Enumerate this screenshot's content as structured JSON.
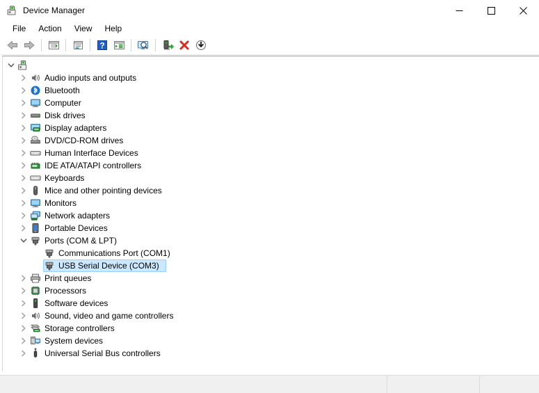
{
  "window": {
    "title": "Device Manager",
    "icon": "device-manager-icon",
    "caption_buttons": [
      {
        "name": "minimize",
        "glyph": "—"
      },
      {
        "name": "maximize",
        "glyph": "□"
      },
      {
        "name": "close",
        "glyph": "✕"
      }
    ]
  },
  "menubar": {
    "items": [
      {
        "label": "File"
      },
      {
        "label": "Action"
      },
      {
        "label": "View"
      },
      {
        "label": "Help"
      }
    ]
  },
  "toolbar": {
    "buttons": [
      {
        "name": "back-button",
        "icon": "back-arrow-icon",
        "tooltip": "Back"
      },
      {
        "name": "forward-button",
        "icon": "forward-arrow-icon",
        "tooltip": "Forward"
      },
      {
        "name": "separator-1",
        "icon": "separator"
      },
      {
        "name": "show-hide-console-tree-button",
        "icon": "console-tree-icon",
        "tooltip": "Show/Hide Console Tree"
      },
      {
        "name": "separator-2",
        "icon": "separator"
      },
      {
        "name": "properties-button",
        "icon": "properties-icon",
        "tooltip": "Properties"
      },
      {
        "name": "separator-3",
        "icon": "separator"
      },
      {
        "name": "help-button",
        "icon": "help-question-icon",
        "tooltip": "Help"
      },
      {
        "name": "view-options-button",
        "icon": "view-list-icon",
        "tooltip": "View"
      },
      {
        "name": "separator-4",
        "icon": "separator"
      },
      {
        "name": "scan-for-hardware-changes-button",
        "icon": "scan-hardware-icon",
        "tooltip": "Scan for hardware changes"
      },
      {
        "name": "separator-5",
        "icon": "separator"
      },
      {
        "name": "enable-device-button",
        "icon": "enable-device-icon",
        "tooltip": "Enable device"
      },
      {
        "name": "uninstall-device-button",
        "icon": "uninstall-red-x-icon",
        "tooltip": "Uninstall device"
      },
      {
        "name": "update-driver-button",
        "icon": "update-driver-download-icon",
        "tooltip": "Update driver"
      }
    ]
  },
  "tree": {
    "nodes": [
      {
        "label": "",
        "icon": "computer-root-icon",
        "level": 0,
        "state": "expanded",
        "selected": false
      },
      {
        "label": "Audio inputs and outputs",
        "icon": "speaker-icon",
        "level": 1,
        "state": "collapsed",
        "selected": false
      },
      {
        "label": "Bluetooth",
        "icon": "bluetooth-icon",
        "level": 1,
        "state": "collapsed",
        "selected": false
      },
      {
        "label": "Computer",
        "icon": "monitor-icon",
        "level": 1,
        "state": "collapsed",
        "selected": false
      },
      {
        "label": "Disk drives",
        "icon": "disk-drive-icon",
        "level": 1,
        "state": "collapsed",
        "selected": false
      },
      {
        "label": "Display adapters",
        "icon": "display-adapter-icon",
        "level": 1,
        "state": "collapsed",
        "selected": false
      },
      {
        "label": "DVD/CD-ROM drives",
        "icon": "optical-drive-icon",
        "level": 1,
        "state": "collapsed",
        "selected": false
      },
      {
        "label": "Human Interface Devices",
        "icon": "hid-icon",
        "level": 1,
        "state": "collapsed",
        "selected": false
      },
      {
        "label": "IDE ATA/ATAPI controllers",
        "icon": "ide-controller-icon",
        "level": 1,
        "state": "collapsed",
        "selected": false
      },
      {
        "label": "Keyboards",
        "icon": "keyboard-icon",
        "level": 1,
        "state": "collapsed",
        "selected": false
      },
      {
        "label": "Mice and other pointing devices",
        "icon": "mouse-icon",
        "level": 1,
        "state": "collapsed",
        "selected": false
      },
      {
        "label": "Monitors",
        "icon": "monitor-icon",
        "level": 1,
        "state": "collapsed",
        "selected": false
      },
      {
        "label": "Network adapters",
        "icon": "network-adapter-icon",
        "level": 1,
        "state": "collapsed",
        "selected": false
      },
      {
        "label": "Portable Devices",
        "icon": "portable-device-icon",
        "level": 1,
        "state": "collapsed",
        "selected": false
      },
      {
        "label": "Ports (COM & LPT)",
        "icon": "port-icon",
        "level": 1,
        "state": "expanded",
        "selected": false
      },
      {
        "label": "Communications Port (COM1)",
        "icon": "port-icon",
        "level": 2,
        "state": "leaf",
        "selected": false
      },
      {
        "label": "USB Serial Device (COM3)",
        "icon": "port-icon",
        "level": 2,
        "state": "leaf",
        "selected": true
      },
      {
        "label": "Print queues",
        "icon": "printer-icon",
        "level": 1,
        "state": "collapsed",
        "selected": false
      },
      {
        "label": "Processors",
        "icon": "processor-icon",
        "level": 1,
        "state": "collapsed",
        "selected": false
      },
      {
        "label": "Software devices",
        "icon": "software-device-icon",
        "level": 1,
        "state": "collapsed",
        "selected": false
      },
      {
        "label": "Sound, video and game controllers",
        "icon": "speaker-icon",
        "level": 1,
        "state": "collapsed",
        "selected": false
      },
      {
        "label": "Storage controllers",
        "icon": "storage-controller-icon",
        "level": 1,
        "state": "collapsed",
        "selected": false
      },
      {
        "label": "System devices",
        "icon": "system-device-icon",
        "level": 1,
        "state": "collapsed",
        "selected": false
      },
      {
        "label": "Universal Serial Bus controllers",
        "icon": "usb-icon",
        "level": 1,
        "state": "collapsed",
        "selected": false
      }
    ]
  },
  "statusbar": {
    "panes": [
      {
        "text": ""
      },
      {
        "text": ""
      },
      {
        "text": ""
      }
    ]
  },
  "colors": {
    "selection_fill": "#cce8ff",
    "selection_border": "#99d1ff",
    "window_bg": "#ffffff",
    "statusbar_bg": "#f0f0f0",
    "text": "#000000"
  }
}
